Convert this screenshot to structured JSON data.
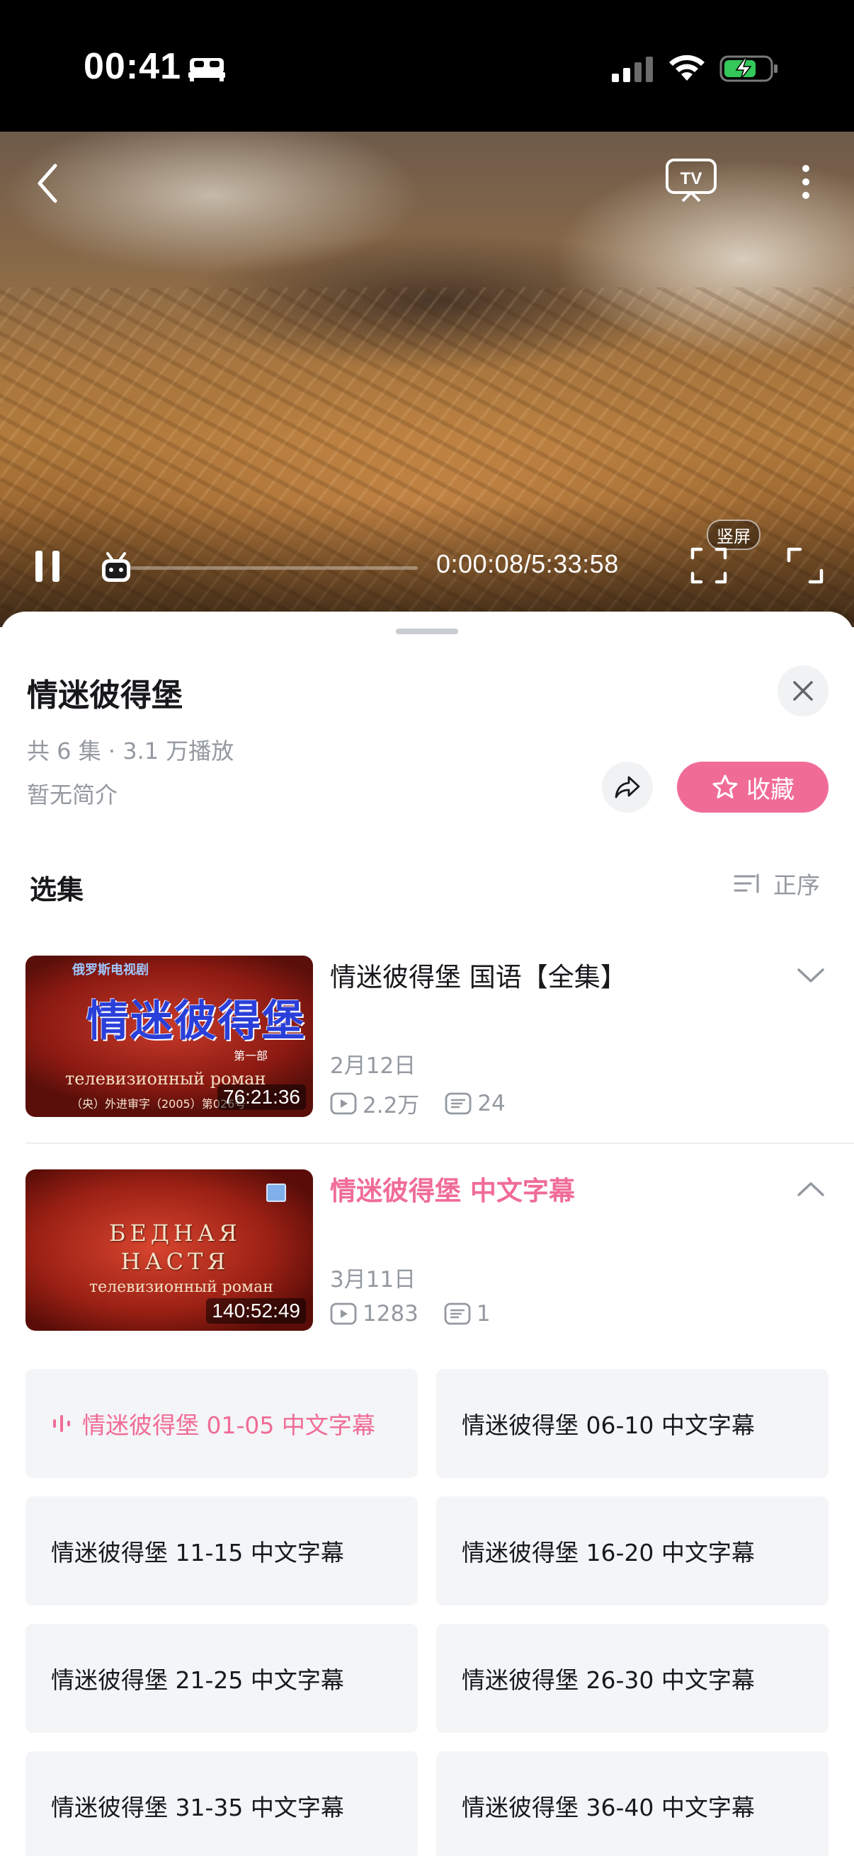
{
  "status_bar": {
    "time": "00:41",
    "icons": [
      "sleep-mode-icon",
      "cellular-signal-icon",
      "wifi-icon",
      "battery-charging-icon"
    ]
  },
  "player": {
    "time_readout": "0:00:08/5:33:58",
    "vertical_label": "竖屏",
    "progress_fraction": 0.0004,
    "icons": [
      "back-icon",
      "cast-tv-icon",
      "more-icon",
      "pause-icon",
      "mascot-thumb-icon",
      "vertical-fullscreen-icon",
      "fullscreen-icon"
    ]
  },
  "sheet": {
    "title": "情迷彼得堡",
    "meta": "共 6 集 · 3.1 万播放",
    "description": "暂无简介",
    "favorite_label": "收藏",
    "section_label": "选集",
    "order_label": "正序"
  },
  "episodes": [
    {
      "title": "情迷彼得堡  国语【全集】",
      "date": "2月12日",
      "views": "2.2万",
      "comments": "24",
      "duration": "76:21:36",
      "expanded": false,
      "thumb": {
        "top": "俄罗斯电视剧",
        "cn_title": "情迷彼得堡",
        "sub": "第一部",
        "ru": "телевизионный роман",
        "bottom": "（央）外进审字（2005）第026号"
      }
    },
    {
      "title": "情迷彼得堡 中文字幕",
      "date": "3月11日",
      "views": "1283",
      "comments": "1",
      "duration": "140:52:49",
      "expanded": true,
      "thumb": {
        "ru_line1": "БЕДНАЯ",
        "ru_line2": "НАСТЯ",
        "ru": "телевизионный роман"
      }
    }
  ],
  "parts": [
    {
      "label": "情迷彼得堡 01-05 中文字幕",
      "active": true
    },
    {
      "label": "情迷彼得堡 06-10 中文字幕",
      "active": false
    },
    {
      "label": "情迷彼得堡 11-15 中文字幕",
      "active": false
    },
    {
      "label": "情迷彼得堡 16-20 中文字幕",
      "active": false
    },
    {
      "label": "情迷彼得堡 21-25 中文字幕",
      "active": false
    },
    {
      "label": "情迷彼得堡 26-30 中文字幕",
      "active": false
    },
    {
      "label": "情迷彼得堡 31-35 中文字幕",
      "active": false
    },
    {
      "label": "情迷彼得堡 36-40 中文字幕",
      "active": false
    }
  ],
  "colors": {
    "accent": "#f06c97",
    "muted_text": "#9499a0",
    "part_bg": "#f4f5f7"
  }
}
